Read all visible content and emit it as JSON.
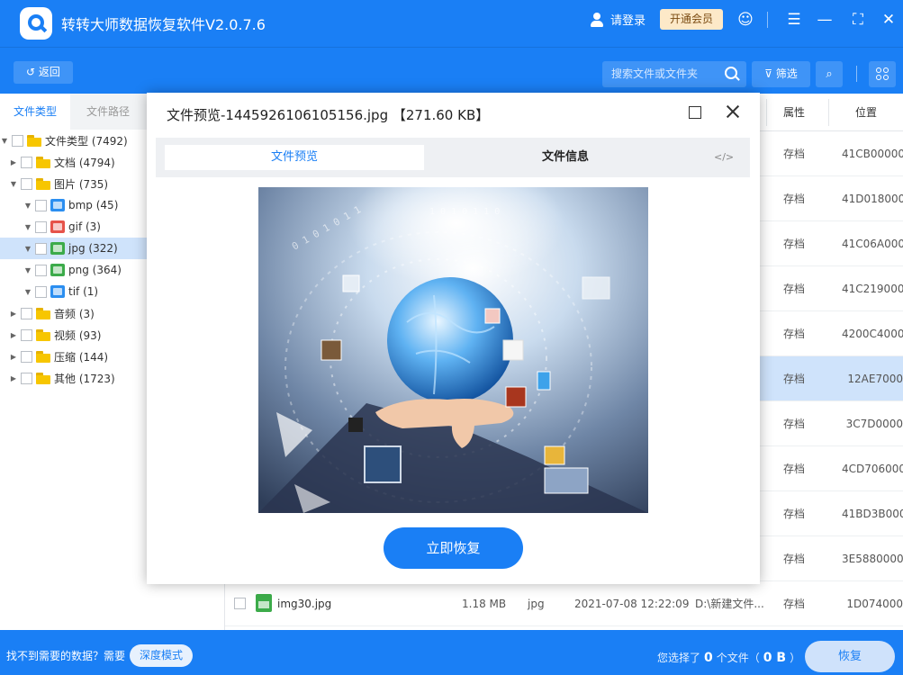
{
  "app": {
    "title": "转转大师数据恢复软件V2.0.7.6",
    "login": "请登录",
    "vip": "开通会员"
  },
  "toolbar": {
    "back": "返回",
    "search_placeholder": "搜索文件或文件夹",
    "filter": "筛选"
  },
  "left": {
    "tabs": [
      "文件类型",
      "文件路径"
    ],
    "tree": [
      {
        "label": "文件类型 (7492)",
        "level": 0,
        "arrow": "▼",
        "icon": "folder"
      },
      {
        "label": "文档 (4794)",
        "level": 1,
        "arrow": "▶",
        "icon": "folder"
      },
      {
        "label": "图片 (735)",
        "level": 1,
        "arrow": "▼",
        "icon": "folder"
      },
      {
        "label": "bmp (45)",
        "level": 2,
        "arrow": "▼",
        "icon": "bmp"
      },
      {
        "label": "gif (3)",
        "level": 2,
        "arrow": "▼",
        "icon": "gif"
      },
      {
        "label": "jpg (322)",
        "level": 2,
        "arrow": "▼",
        "icon": "jpg"
      },
      {
        "label": "png (364)",
        "level": 2,
        "arrow": "▼",
        "icon": "png"
      },
      {
        "label": "tif (1)",
        "level": 2,
        "arrow": "▼",
        "icon": "tif"
      },
      {
        "label": "音频 (3)",
        "level": 1,
        "arrow": "▶",
        "icon": "folder"
      },
      {
        "label": "视频 (93)",
        "level": 1,
        "arrow": "▶",
        "icon": "folder"
      },
      {
        "label": "压缩 (144)",
        "level": 1,
        "arrow": "▶",
        "icon": "folder"
      },
      {
        "label": "其他 (1723)",
        "level": 1,
        "arrow": "▶",
        "icon": "folder"
      }
    ]
  },
  "list": {
    "headers": {
      "attr": "属性",
      "location": "位置"
    },
    "rows": [
      {
        "attr": "存档",
        "loc": "41CB00000"
      },
      {
        "attr": "存档",
        "loc": "41D018000"
      },
      {
        "attr": "存档",
        "loc": "41C06A000"
      },
      {
        "attr": "存档",
        "loc": "41C219000"
      },
      {
        "attr": "存档",
        "loc": "4200C4000"
      },
      {
        "attr": "存档",
        "loc": "12AE7000"
      },
      {
        "attr": "存档",
        "loc": "3C7D0000"
      },
      {
        "attr": "存档",
        "loc": "4CD706000"
      },
      {
        "attr": "存档",
        "loc": "41BD3B000"
      },
      {
        "attr": "存档",
        "loc": "3E5880000"
      }
    ],
    "last_row": {
      "name": "img30.jpg",
      "size": "1.18 MB",
      "type": "jpg",
      "date": "2021-07-08 12:22:09",
      "path": "D:\\新建文件...",
      "attr": "存档",
      "loc": "1D074000"
    }
  },
  "modal": {
    "title": "文件预览-1445926106105156.jpg 【271.60 KB】",
    "tab_preview": "文件预览",
    "tab_info": "文件信息",
    "code": "</>",
    "recover_now": "立即恢复"
  },
  "bottom": {
    "hint": "找不到需要的数据？需要",
    "deep_mode": "深度模式",
    "selected_prefix": "您选择了",
    "selected_count": "0",
    "selected_mid": "个文件（",
    "selected_size": "0 B",
    "selected_suffix": "）",
    "recover": "恢复"
  },
  "colors": {
    "accent": "#1a7ff5",
    "selected_row": "#cfe3fb"
  }
}
